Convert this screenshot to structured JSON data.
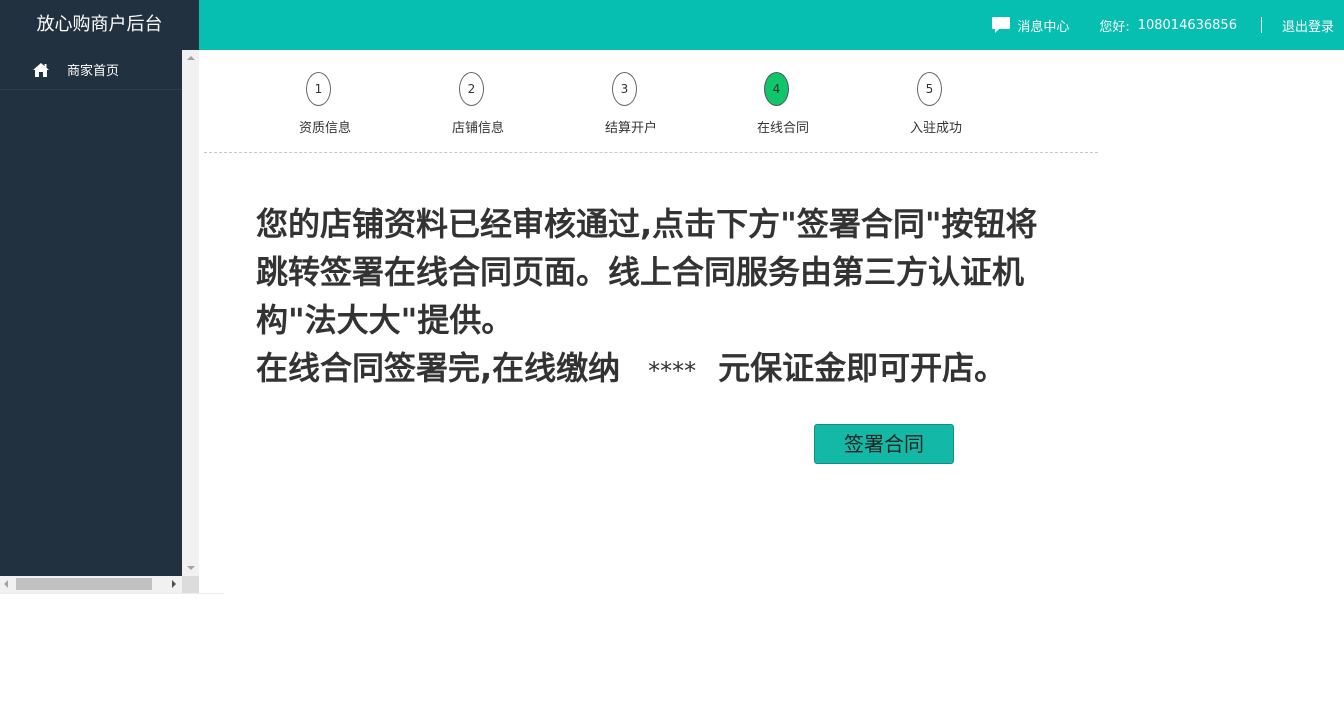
{
  "header": {
    "brand": "放心购商户后台",
    "message_center": "消息中心",
    "greeting_label": "您好:",
    "username": "108014636856",
    "logout": "退出登录"
  },
  "sidebar": {
    "items": [
      {
        "label": "商家首页",
        "icon": "home-icon"
      }
    ]
  },
  "steps": [
    {
      "number": "1",
      "label": "资质信息",
      "active": false
    },
    {
      "number": "2",
      "label": "店铺信息",
      "active": false
    },
    {
      "number": "3",
      "label": "结算开户",
      "active": false
    },
    {
      "number": "4",
      "label": "在线合同",
      "active": true
    },
    {
      "number": "5",
      "label": "入驻成功",
      "active": false
    }
  ],
  "content": {
    "line1": "您的店铺资料已经审核通过,点击下方\"签署合同\"按钮将",
    "line2": "跳转签署在线合同页面。线上合同服务由第三方认证机",
    "line3": "构\"法大大\"提供。",
    "line4_prefix": "在线合同签署完,在线缴纳",
    "deposit_amount": "****",
    "line4_suffix": "元保证金即可开店。",
    "sign_button": "签署合同"
  },
  "colors": {
    "topbar": "#06bfb0",
    "sidebar": "#22313f",
    "active_step": "#0fc76a",
    "button": "#13b9a6"
  }
}
